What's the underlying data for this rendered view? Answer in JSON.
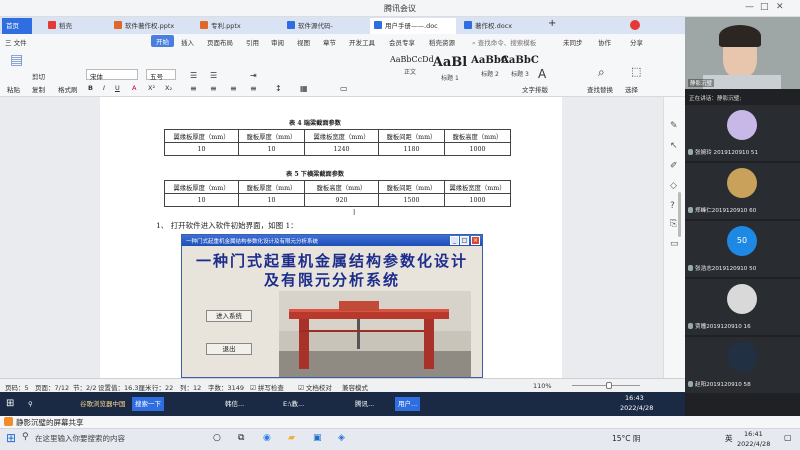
{
  "meeting": {
    "title": "腾讯会议"
  },
  "wps_tabs": [
    {
      "label": "首页",
      "color": "#2f6ee0"
    },
    {
      "label": "稻壳",
      "color": "#e53935"
    },
    {
      "label": "软件著作权.pptx",
      "color": "#e0672a"
    },
    {
      "label": "专利.pptx",
      "color": "#e0672a"
    },
    {
      "label": "软件源代码-",
      "color": "#2f6ee0"
    },
    {
      "label": "用户手册——.doc",
      "color": "#2f6ee0"
    },
    {
      "label": "著作权.docx",
      "color": "#2f6ee0"
    }
  ],
  "ribbon_menu": [
    "三 文件",
    "开始",
    "插入",
    "页面布局",
    "引用",
    "审阅",
    "视图",
    "章节",
    "开发工具",
    "会员专享",
    "稻壳资源",
    "查找命令、搜索模板",
    "未同步",
    "协作",
    "分享"
  ],
  "ribbon_tools": {
    "paste": "粘贴",
    "cut": "剪切",
    "copy": "复制",
    "format_painter": "格式刷",
    "font": "宋体",
    "font_size": "五号",
    "text_layout": "文字排版",
    "find_replace": "查找替换",
    "select": "选择"
  },
  "styles": [
    {
      "sample": "AaBbCcDd",
      "label": "正文"
    },
    {
      "sample": "AaBl",
      "label": "标题 1"
    },
    {
      "sample": "AaBbC",
      "label": "标题 2"
    },
    {
      "sample": "AaBbC",
      "label": "标题 3"
    }
  ],
  "table4": {
    "caption": "表 4  端梁截面参数",
    "headers": [
      "翼缘板厚度（mm）",
      "腹板厚度（mm）",
      "翼缘板宽度（mm）",
      "腹板间距（mm）",
      "腹板高度（mm）"
    ],
    "row": [
      "10",
      "10",
      "1240",
      "1180",
      "1000"
    ]
  },
  "table5": {
    "caption": "表 5  下横梁截面参数",
    "headers": [
      "翼缘板厚度（mm）",
      "腹板厚度（mm）",
      "腹板高度（mm）",
      "腹板间距（mm）",
      "翼缘板宽度（mm）"
    ],
    "row": [
      "10",
      "10",
      "920",
      "1500",
      "1000"
    ]
  },
  "doc_step": "1、 打开软件进入软件初始界面，如图 1：",
  "software_window": {
    "title": "一种门式起重机金属结构参数化设计及有限元分析系统",
    "heading_line1": "一种门式起重机金属结构参数化设计",
    "heading_line2": "及有限元分析系统",
    "enter_button": "进入系统",
    "exit_button": "退出"
  },
  "status": {
    "page": "页码：5",
    "pages": "页面：7/12",
    "section": "节：2/2",
    "position": "设置值：16.3厘米",
    "row": "行：22",
    "col": "列：12",
    "words": "字数：3149",
    "spell": "拼写检查",
    "compare": "文档校对",
    "compat": "兼容模式",
    "zoom": "110%"
  },
  "inner_taskbar": {
    "items": [
      "谷歌浏览器中国",
      "搜索一下",
      "韩信...",
      "E:\\教...",
      "腾讯...",
      "用户..."
    ],
    "time": "16:43",
    "date": "2022/4/28"
  },
  "share_bar": {
    "label": "静影沉璧的屏幕共享"
  },
  "win_taskbar": {
    "search_placeholder": "在这里输入你要搜索的内容",
    "weather": "15°C 阴",
    "ime": "英",
    "time": "16:41",
    "date": "2022/4/28"
  },
  "panel": {
    "speaking": "正在讲话：静影沉璧;",
    "host_name": "静影沉璧",
    "participants": [
      {
        "name": "张婉玲 2019120910 51",
        "avatar_color": "#c7b8e8"
      },
      {
        "name": "郑峰仁2019120910 60",
        "avatar_color": "#c9a15a"
      },
      {
        "name": "张浩志2019120910 50",
        "avatar_color": "#1e88e5",
        "initials": "50"
      },
      {
        "name": "贾瞳2019120910 16",
        "avatar_color": "#d9d9d9"
      },
      {
        "name": "赵阳2019120910 58",
        "avatar_color": "#223044"
      }
    ]
  }
}
